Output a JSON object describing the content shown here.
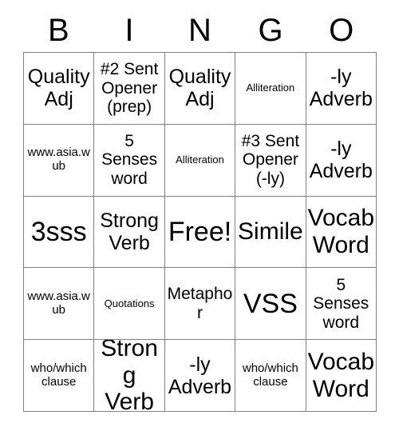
{
  "card": {
    "header": {
      "letters": [
        "B",
        "I",
        "N",
        "G",
        "O"
      ]
    },
    "rows": [
      [
        {
          "text": "Quality Adj",
          "size": "lg"
        },
        {
          "text": "#2 Sent Opener (prep)",
          "size": "md"
        },
        {
          "text": "Quality Adj",
          "size": "lg"
        },
        {
          "text": "Alliteration",
          "size": "xs"
        },
        {
          "text": "-ly Adverb",
          "size": "lg"
        }
      ],
      [
        {
          "text": "www.asia.wub",
          "size": "sm"
        },
        {
          "text": "5 Senses word",
          "size": "md"
        },
        {
          "text": "Alliteration",
          "size": "xs"
        },
        {
          "text": "#3 Sent Opener (-ly)",
          "size": "md"
        },
        {
          "text": "-ly Adverb",
          "size": "lg"
        }
      ],
      [
        {
          "text": "3sss",
          "size": "xxl"
        },
        {
          "text": "Strong Verb",
          "size": "lg"
        },
        {
          "text": "Free!",
          "size": "xxl"
        },
        {
          "text": "Simile",
          "size": "xl"
        },
        {
          "text": "Vocab Word",
          "size": "xl"
        }
      ],
      [
        {
          "text": "www.asia.wub",
          "size": "sm"
        },
        {
          "text": "Quotations",
          "size": "xs"
        },
        {
          "text": "Metaphor",
          "size": "md"
        },
        {
          "text": "VSS",
          "size": "xxl"
        },
        {
          "text": "5 Senses word",
          "size": "md"
        }
      ],
      [
        {
          "text": "who/which clause",
          "size": "sm"
        },
        {
          "text": "Strong Verb",
          "size": "xl"
        },
        {
          "text": "-ly Adverb",
          "size": "lg"
        },
        {
          "text": "who/which clause",
          "size": "sm"
        },
        {
          "text": "Vocab Word",
          "size": "xl"
        }
      ]
    ]
  }
}
